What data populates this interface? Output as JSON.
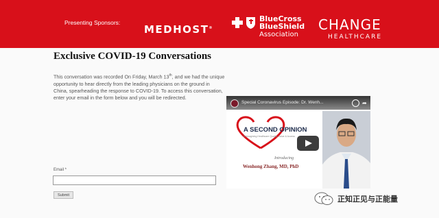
{
  "header": {
    "sponsors_label": "Presenting Sponsors:",
    "medhost_logo": "MEDHOST",
    "bcbs_line1": "BlueCross",
    "bcbs_line2": "BlueShield",
    "bcbs_assoc": "Association",
    "change_logo_main": "CHANGE",
    "change_logo_sub": "HEALTHCARE"
  },
  "main": {
    "title": "Exclusive COVID-19 Conversations",
    "body_before": "This conversation was recorded On Friday, March 13",
    "body_sup": "th",
    "body_after": ", and we had the unique opportunity to hear directly from the leading physicians on the ground in China, spearheading the response to COVID-19. To access this conversation, enter your email in the form below and you will be redirected.",
    "email_label": "Email *",
    "email_value": "",
    "submit_label": "Submit"
  },
  "video": {
    "title": "Special Coronavirus Episode: Dr. Wenh...",
    "heading": "A SECOND OPINION",
    "tagline": "Reimagining Healthcare Quality, Value & Access",
    "introducing": "Introducing",
    "speaker": "Wenhong Zhang, MD, PhD"
  },
  "watermark": {
    "text": "正知正见与正能量"
  },
  "colors": {
    "brand_red": "#d8101a"
  }
}
